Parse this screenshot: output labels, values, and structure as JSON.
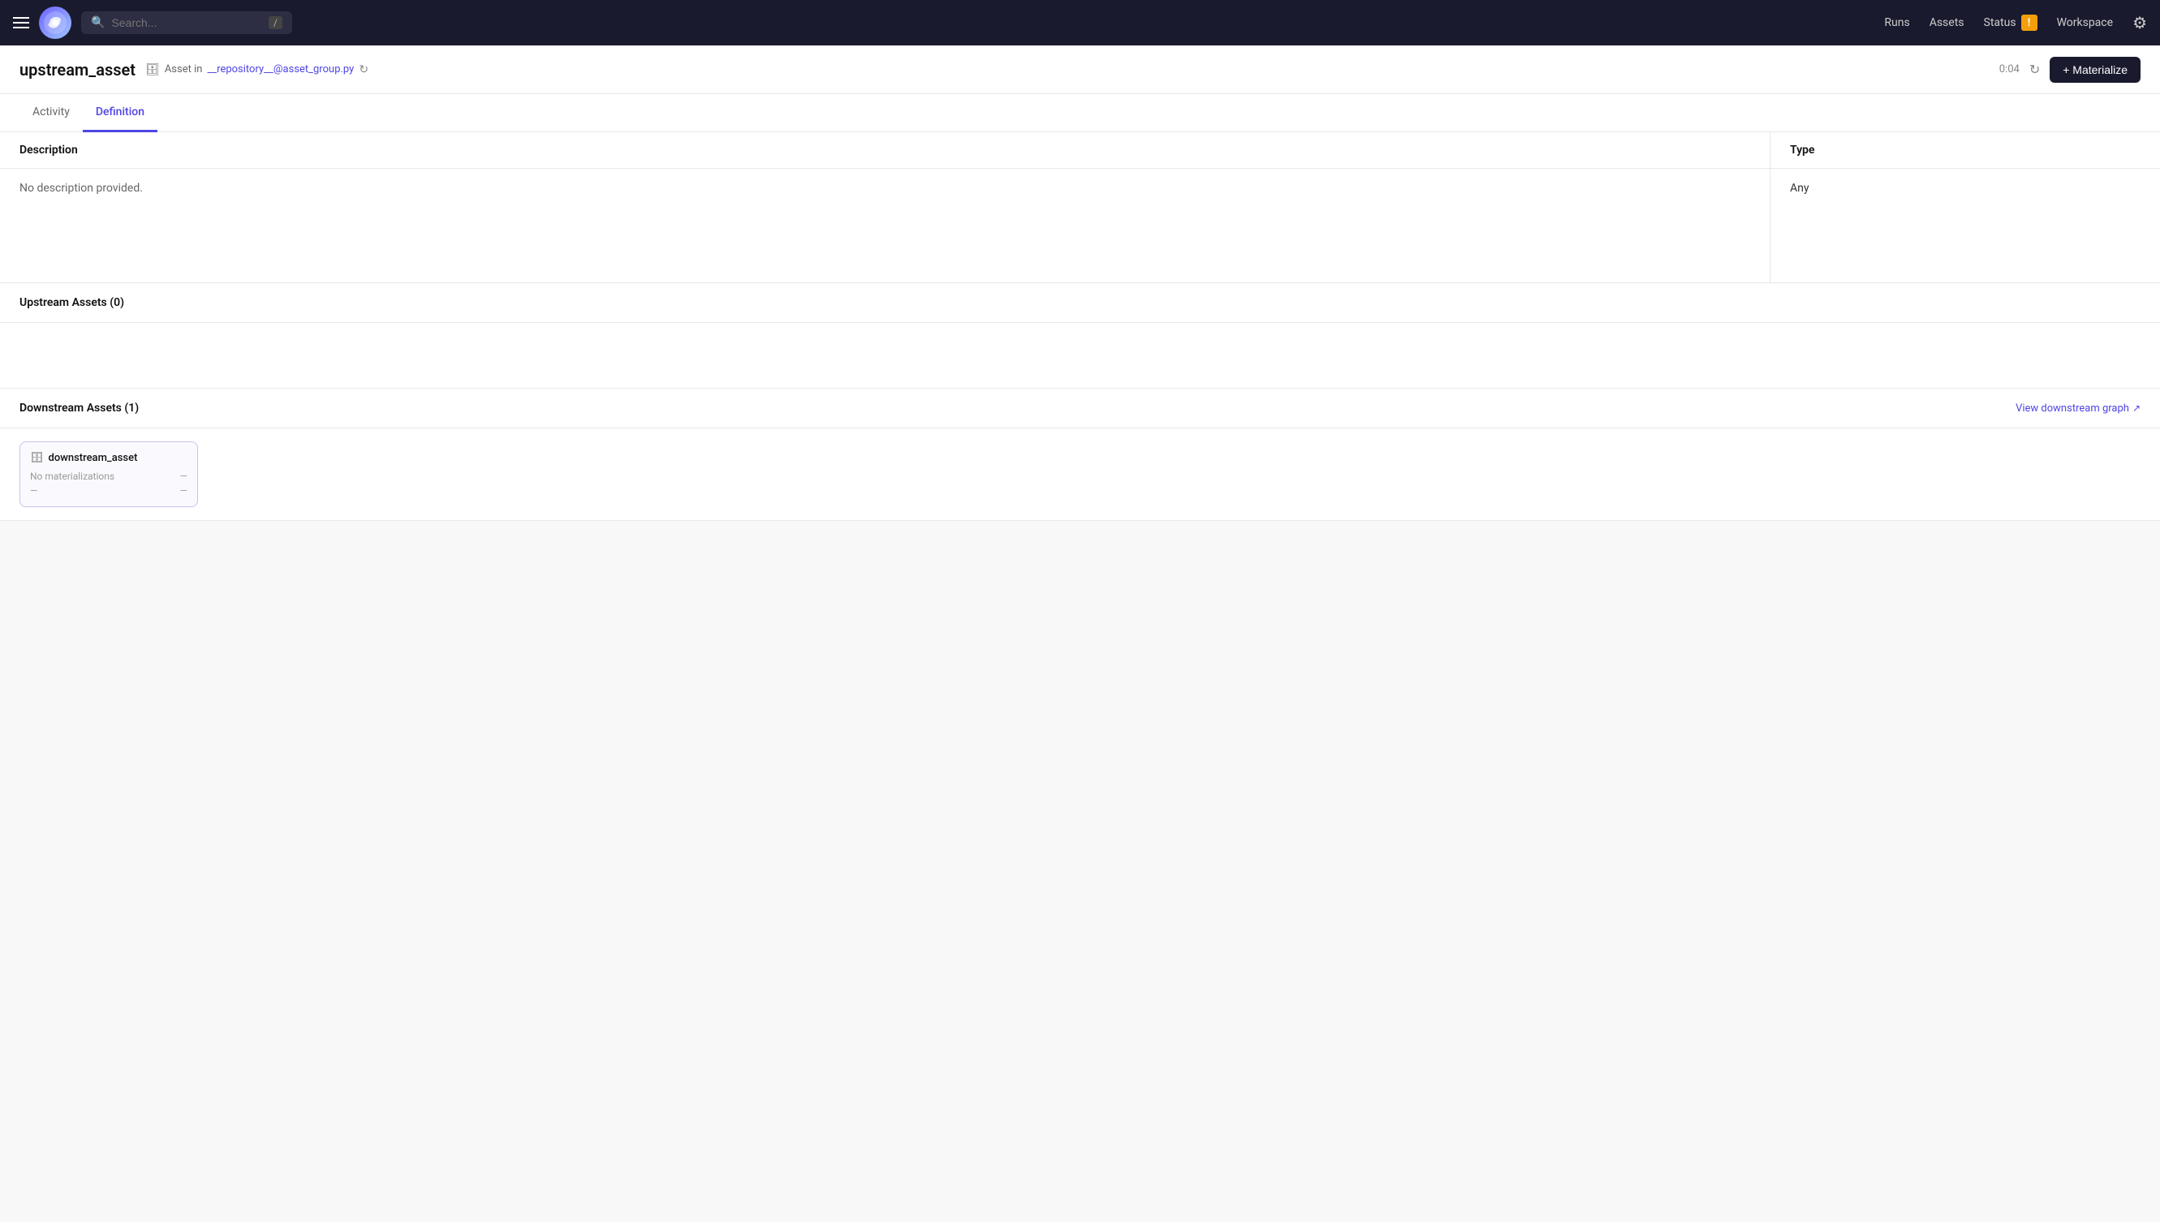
{
  "topnav": {
    "search_placeholder": "Search...",
    "search_shortcut": "/",
    "nav_items": [
      {
        "label": "Runs",
        "key": "runs"
      },
      {
        "label": "Assets",
        "key": "assets"
      },
      {
        "label": "Status",
        "key": "status"
      },
      {
        "label": "Workspace",
        "key": "workspace"
      }
    ],
    "status_warning": "!"
  },
  "page": {
    "title": "upstream_asset",
    "asset_location_prefix": "Asset in",
    "asset_file": "__repository__@asset_group.py",
    "timer": "0:04",
    "materialize_label": "+ Materialize"
  },
  "tabs": [
    {
      "label": "Activity",
      "key": "activity",
      "active": false
    },
    {
      "label": "Definition",
      "key": "definition",
      "active": true
    }
  ],
  "definition": {
    "description_header": "Description",
    "type_header": "Type",
    "description_value": "No description provided.",
    "type_value": "Any",
    "upstream_header": "Upstream Assets (0)",
    "downstream_header": "Downstream Assets (1)",
    "view_downstream_label": "View downstream graph",
    "downstream_assets": [
      {
        "name": "downstream_asset",
        "stats_label": "No materializations",
        "stats_value": "—",
        "row_left": "—",
        "row_right": "—"
      }
    ]
  }
}
